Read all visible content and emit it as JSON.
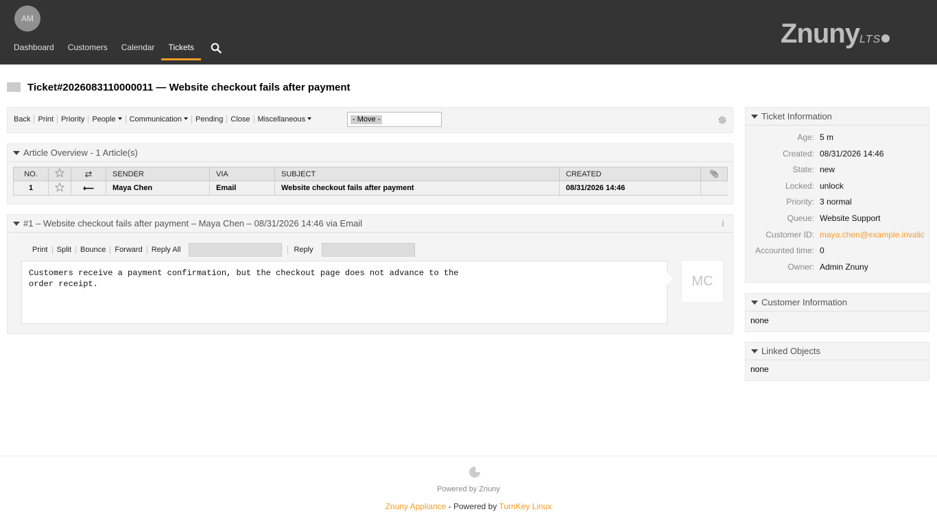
{
  "header": {
    "avatar_initials": "AM",
    "nav": [
      {
        "label": "Dashboard"
      },
      {
        "label": "Customers"
      },
      {
        "label": "Calendar"
      },
      {
        "label": "Tickets",
        "active": true
      }
    ],
    "logo_text": "Znuny",
    "logo_suffix": "LTS",
    "accent_color": "#f79d28"
  },
  "ticket": {
    "title": "Ticket#2026083110000011 — Website checkout fails after payment"
  },
  "action_bar": {
    "items": [
      "Back",
      "Print",
      "Priority",
      "People",
      "Communication",
      "Pending",
      "Close",
      "Miscellaneous"
    ],
    "move_placeholder": "- Move -"
  },
  "article_overview": {
    "heading": "Article Overview - 1 Article(s)",
    "columns": {
      "no": "NO.",
      "sender": "SENDER",
      "via": "VIA",
      "subject": "SUBJECT",
      "created": "CREATED"
    },
    "rows": [
      {
        "no": "1",
        "direction": "⟵",
        "sender": "Maya Chen",
        "via": "Email",
        "subject": "Website checkout fails after payment",
        "created": "08/31/2026 14:46"
      }
    ]
  },
  "article": {
    "heading": "#1 – Website checkout fails after payment – Maya Chen – 08/31/2026 14:46 via Email",
    "actions": {
      "print": "Print",
      "split": "Split",
      "bounce": "Bounce",
      "forward": "Forward",
      "reply_all": "Reply All",
      "reply": "Reply"
    },
    "body": "Customers receive a payment confirmation, but the checkout page does not advance to the\norder receipt.",
    "sender_initials": "MC"
  },
  "ticket_information": {
    "heading": "Ticket Information",
    "fields": [
      {
        "label": "Age:",
        "value": "5 m"
      },
      {
        "label": "Created:",
        "value": "08/31/2026 14:46"
      },
      {
        "label": "State:",
        "value": "new"
      },
      {
        "label": "Locked:",
        "value": "unlock"
      },
      {
        "label": "Priority:",
        "value": "3 normal"
      },
      {
        "label": "Queue:",
        "value": "Website Support"
      },
      {
        "label": "Customer ID:",
        "value": "maya.chen@example.invalid"
      },
      {
        "label": "Accounted time:",
        "value": "0"
      },
      {
        "label": "Owner:",
        "value": "Admin Znuny"
      }
    ]
  },
  "customer_information": {
    "heading": "Customer Information",
    "value": "none"
  },
  "linked_objects": {
    "heading": "Linked Objects",
    "value": "none"
  },
  "footer": {
    "powered": "Powered by Znuny",
    "appliance": "Znuny Appliance",
    "powered_by_sep": " - Powered by ",
    "turnkey": "TurnKey Linux"
  }
}
